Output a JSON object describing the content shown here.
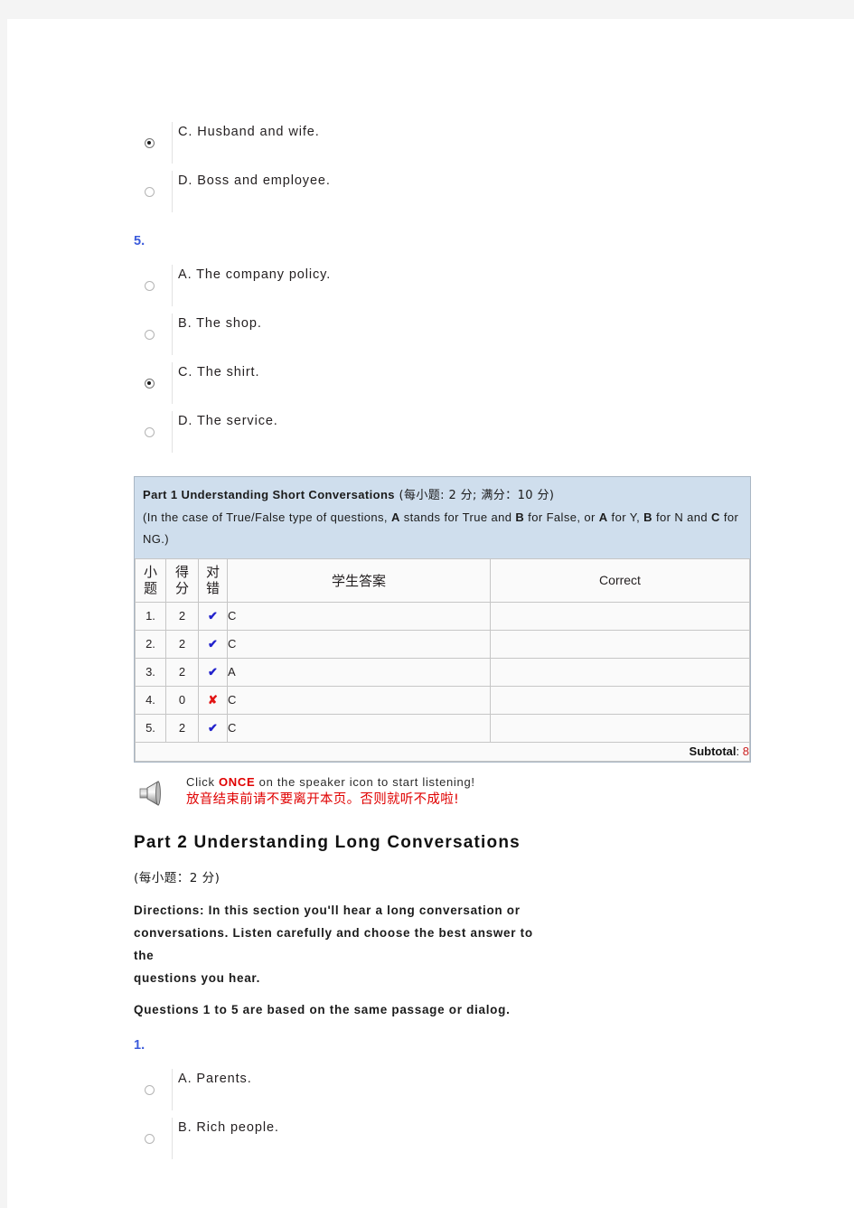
{
  "questions_top": {
    "continued_options": [
      {
        "id": "q4-opt-c",
        "label": "C.  Husband  and  wife.",
        "selected": true
      },
      {
        "id": "q4-opt-d",
        "label": "D.  Boss  and  employee.",
        "selected": false
      }
    ],
    "question5": {
      "number": "5.",
      "options": [
        {
          "id": "q5-opt-a",
          "label": "A.  The  company  policy.",
          "selected": false
        },
        {
          "id": "q5-opt-b",
          "label": "B.  The  shop.",
          "selected": false
        },
        {
          "id": "q5-opt-c",
          "label": "C.  The  shirt.",
          "selected": true
        },
        {
          "id": "q5-opt-d",
          "label": "D.  The  service.",
          "selected": false
        }
      ]
    }
  },
  "results": {
    "title_bold": "Part 1 Understanding Short Conversations",
    "title_rest": " (每小题: 2 分; 满分：10 分)",
    "note_prefix": "(In the case of True/False type of questions, ",
    "note_a1": "A",
    "note_mid1": " stands for True and ",
    "note_b1": "B",
    "note_mid2": " for False, or ",
    "note_a2": "A",
    "note_mid3": " for Y, ",
    "note_b2": "B",
    "note_mid4": " for N and ",
    "note_c": "C",
    "note_suffix": " for NG.)",
    "columns": {
      "no": "小题",
      "score": "得分",
      "mark": "对错",
      "student_answer": "学生答案",
      "correct": "Correct"
    },
    "rows": [
      {
        "no": "1.",
        "score": "2",
        "mark": "✔",
        "mark_type": "tick",
        "student_answer": "C",
        "correct": ""
      },
      {
        "no": "2.",
        "score": "2",
        "mark": "✔",
        "mark_type": "tick",
        "student_answer": "C",
        "correct": ""
      },
      {
        "no": "3.",
        "score": "2",
        "mark": "✔",
        "mark_type": "tick",
        "student_answer": "A",
        "correct": ""
      },
      {
        "no": "4.",
        "score": "0",
        "mark": "✘",
        "mark_type": "cross",
        "student_answer": "C",
        "correct": ""
      },
      {
        "no": "5.",
        "score": "2",
        "mark": "✔",
        "mark_type": "tick",
        "student_answer": "C",
        "correct": ""
      }
    ],
    "subtotal_label": "Subtotal",
    "subtotal_separator": ": ",
    "subtotal_value": "8"
  },
  "notice": {
    "icon": "speaker-icon",
    "en_before": "Click ",
    "en_strong": "ONCE",
    "en_after": " on  the  speaker  icon  to  start  listening!",
    "cn": "放音结束前请不要离开本页。否则就听不成啦!"
  },
  "part2": {
    "title": "Part  2  Understanding  Long  Conversations",
    "score_note": "(每小题：2  分)",
    "directions_line1": "Directions:  In  this  section  you'll  hear  a  long  conversation  or",
    "directions_line2": "conversations.  Listen  carefully  and  choose  the  best  answer  to  the",
    "directions_line3": "questions  you  hear.",
    "questions_line": "Questions  1  to  5  are  based  on  the  same  passage  or  dialog.",
    "question1": {
      "number": "1.",
      "options": [
        {
          "id": "p2-q1-opt-a",
          "label": "A.  Parents.",
          "selected": false
        },
        {
          "id": "p2-q1-opt-b",
          "label": "B.  Rich  people.",
          "selected": false
        }
      ]
    }
  },
  "colors": {
    "question_number": "#3b5bdb",
    "table_header_bg": "#cfdeed",
    "tick": "#2222cc",
    "cross": "#e21414",
    "alert_red": "#e00000",
    "subtotal_value": "#cc2222"
  }
}
